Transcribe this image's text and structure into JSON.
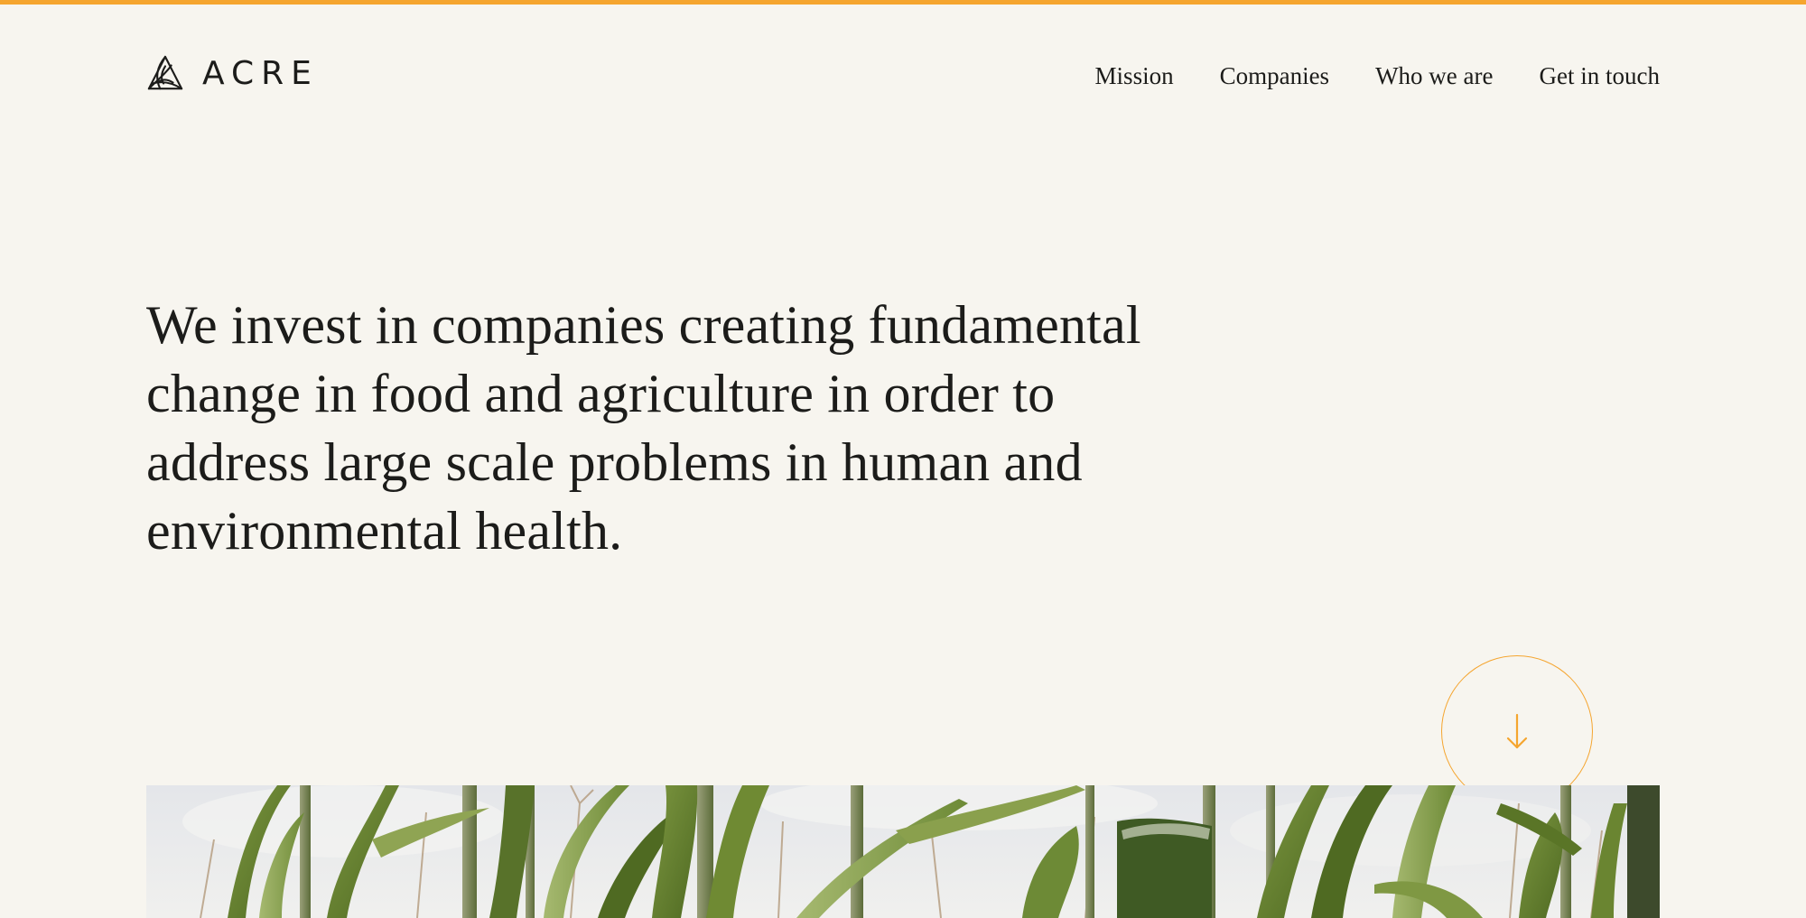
{
  "brand": {
    "name": "ACRE",
    "accent_color": "#f5a52f",
    "background_color": "#f7f5ef",
    "text_color": "#1c1c1a"
  },
  "nav": {
    "items": [
      {
        "label": "Mission"
      },
      {
        "label": "Companies"
      },
      {
        "label": "Who we are"
      },
      {
        "label": "Get in touch"
      }
    ]
  },
  "hero": {
    "headline": "We invest in companies creating fundamental change in food and agriculture in order to address large scale problems in human and environmental health.",
    "scroll_icon": "arrow-down-icon",
    "image_subject": "corn-field-photo"
  },
  "icons": {
    "logo": "acre-logo-icon",
    "scroll": "arrow-down-icon"
  }
}
